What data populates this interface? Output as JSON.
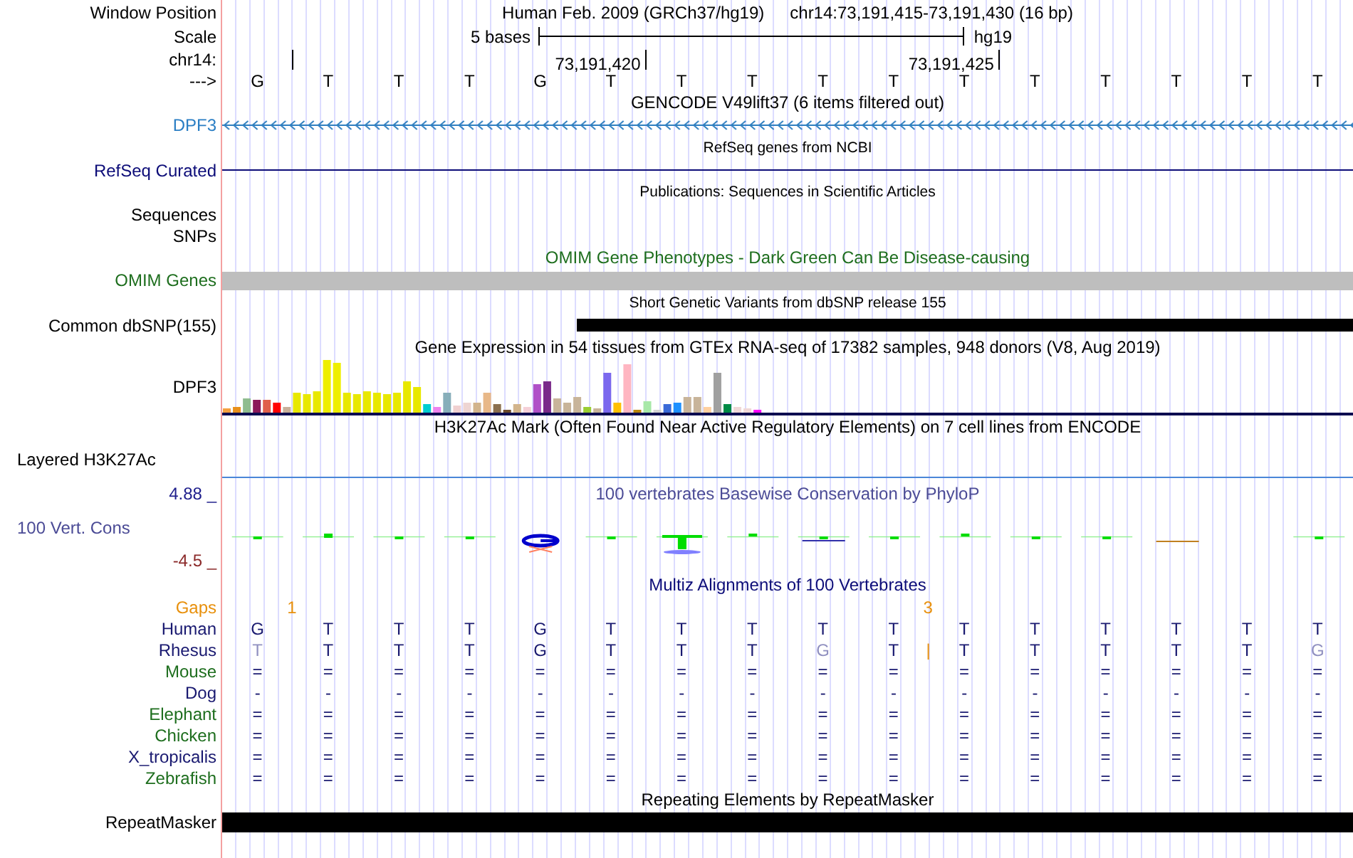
{
  "position_bar": {
    "label": "Window Position",
    "assembly": "Human Feb. 2009 (GRCh37/hg19)",
    "range": "chr14:73,191,415-73,191,430 (16 bp)"
  },
  "scale": {
    "label": "Scale",
    "length": "5 bases",
    "database": "hg19"
  },
  "ruler": {
    "label": "chr14:",
    "ticks": [
      "73,191,420",
      "73,191,425"
    ]
  },
  "sequence": {
    "label": "--->",
    "bases": [
      "G",
      "T",
      "T",
      "T",
      "G",
      "T",
      "T",
      "T",
      "T",
      "T",
      "T",
      "T",
      "T",
      "T",
      "T",
      "T"
    ]
  },
  "tracks": [
    {
      "kind": "gene",
      "title": "GENCODE V49lift37 (6 items filtered out)",
      "labels": [
        "DPF3"
      ]
    },
    {
      "kind": "refseq",
      "title": "RefSeq genes from NCBI",
      "labels": [
        "RefSeq Curated"
      ]
    },
    {
      "kind": "publications",
      "title": "Publications: Sequences in Scientific Articles",
      "labels": [
        "Sequences",
        "SNPs"
      ]
    },
    {
      "kind": "omim",
      "title": "OMIM Gene Phenotypes - Dark Green Can Be Disease-causing",
      "labels": [
        "OMIM Genes"
      ]
    },
    {
      "kind": "snp",
      "title": "Short Genetic Variants from dbSNP release 155",
      "labels": [
        "Common dbSNP(155)"
      ]
    },
    {
      "kind": "expression",
      "title": "Gene Expression in 54 tissues from GTEx RNA-seq of 17382 samples, 948 donors (V8, Aug 2019)",
      "labels": [
        "DPF3"
      ]
    },
    {
      "kind": "h3k27ac",
      "title": "H3K27Ac Mark (Often Found Near Active Regulatory Elements) on 7 cell lines from ENCODE",
      "labels": [
        "Layered H3K27Ac"
      ]
    },
    {
      "kind": "conservation",
      "title": "100 vertebrates Basewise Conservation by PhyloP",
      "labels": [
        "4.88 _",
        "100 Vert. Cons",
        "-4.5 _"
      ]
    },
    {
      "kind": "alignment",
      "title": "Multiz Alignments of 100 Vertebrates",
      "gaps": {
        "label": "Gaps",
        "counts": [
          "1",
          "3"
        ]
      },
      "species": [
        {
          "name": "Human",
          "color": "#191970",
          "bases": [
            "G",
            "T",
            "T",
            "T",
            "G",
            "T",
            "T",
            "T",
            "T",
            "T",
            "T",
            "T",
            "T",
            "T",
            "T",
            "T"
          ]
        },
        {
          "name": "Rhesus",
          "color": "#191970",
          "insertion": "|",
          "bases": [
            "T",
            "T",
            "T",
            "T",
            "G",
            "T",
            "T",
            "T",
            "G",
            "T",
            "T",
            "T",
            "T",
            "T",
            "T",
            "G"
          ],
          "mismatch": [
            true,
            false,
            false,
            false,
            false,
            false,
            false,
            false,
            true,
            false,
            false,
            false,
            false,
            false,
            false,
            true
          ]
        },
        {
          "name": "Mouse",
          "color": "#1e6e1e",
          "bases": [
            "=",
            "=",
            "=",
            "=",
            "=",
            "=",
            "=",
            "=",
            "=",
            "=",
            "=",
            "=",
            "=",
            "=",
            "=",
            "="
          ]
        },
        {
          "name": "Dog",
          "color": "#191970",
          "bases": [
            "-",
            "-",
            "-",
            "-",
            "-",
            "-",
            "-",
            "-",
            "-",
            "-",
            "-",
            "-",
            "-",
            "-",
            "-",
            "-"
          ]
        },
        {
          "name": "Elephant",
          "color": "#1e6e1e",
          "bases": [
            "=",
            "=",
            "=",
            "=",
            "=",
            "=",
            "=",
            "=",
            "=",
            "=",
            "=",
            "=",
            "=",
            "=",
            "=",
            "="
          ]
        },
        {
          "name": "Chicken",
          "color": "#1e6e1e",
          "bases": [
            "=",
            "=",
            "=",
            "=",
            "=",
            "=",
            "=",
            "=",
            "=",
            "=",
            "=",
            "=",
            "=",
            "=",
            "=",
            "="
          ]
        },
        {
          "name": "X_tropicalis",
          "color": "#191970",
          "bases": [
            "=",
            "=",
            "=",
            "=",
            "=",
            "=",
            "=",
            "=",
            "=",
            "=",
            "=",
            "=",
            "=",
            "=",
            "=",
            "="
          ]
        },
        {
          "name": "Zebrafish",
          "color": "#1e6e1e",
          "bases": [
            "=",
            "=",
            "=",
            "=",
            "=",
            "=",
            "=",
            "=",
            "=",
            "=",
            "=",
            "=",
            "=",
            "=",
            "=",
            "="
          ]
        }
      ]
    },
    {
      "kind": "repeats",
      "title": "Repeating Elements by RepeatMasker",
      "labels": [
        "RepeatMasker"
      ]
    }
  ]
}
